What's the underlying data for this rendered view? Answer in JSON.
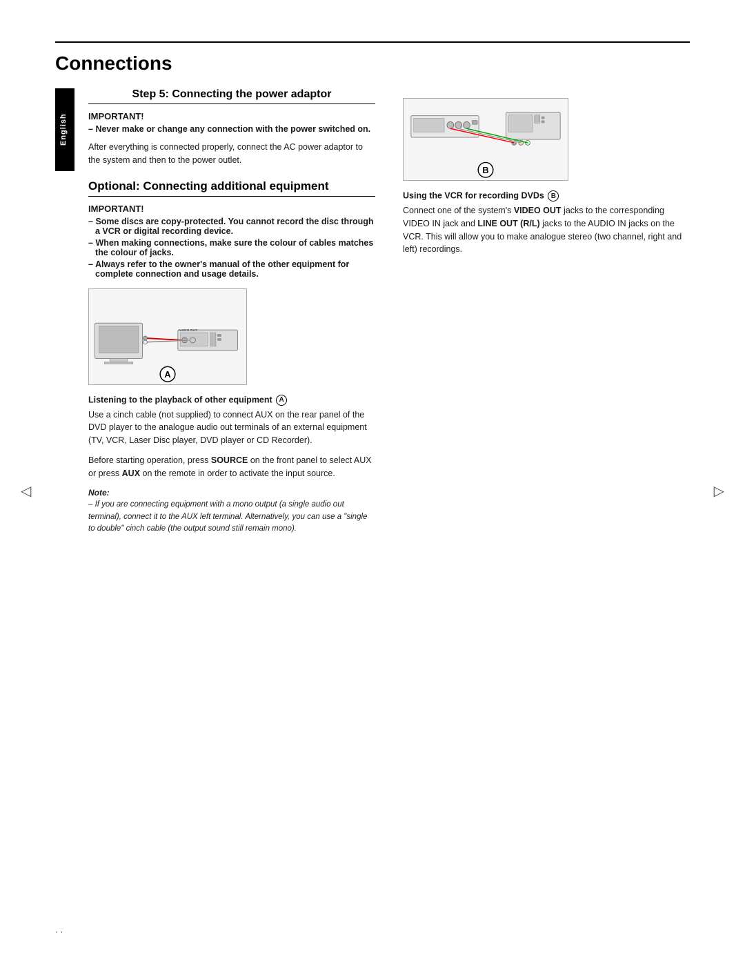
{
  "page": {
    "title": "Connections",
    "top_rule": true,
    "page_number": "· ·",
    "language_tab": "English"
  },
  "step5": {
    "heading": "Step 5:  Connecting the power adaptor",
    "important_label": "IMPORTANT!",
    "important_bullets": [
      "Never make or change any connection with the power switched on."
    ],
    "body_text": "After everything is connected properly, connect the AC power adaptor to the system and then to the power outlet."
  },
  "optional": {
    "heading": "Optional: Connecting additional equipment",
    "important_label": "IMPORTANT!",
    "important_bullets": [
      "Some discs are copy-protected. You cannot record the disc through a VCR or digital recording device.",
      "When making connections, make sure the colour of cables matches the colour of jacks.",
      "Always refer to the owner's manual of the other equipment for complete connection and usage details."
    ],
    "diagram_a_label": "A",
    "listening_heading": "Listening to the playback of other equipment",
    "listening_circle": "A",
    "listening_body1": "Use a cinch cable (not supplied) to connect AUX on the rear panel of the DVD player to the analogue audio out terminals of an external equipment (TV, VCR, Laser Disc player, DVD player or CD Recorder).",
    "listening_body2": "Before starting operation, press SOURCE on the front panel to select AUX or press AUX on the remote in order to activate the input source.",
    "listening_source_bold": "SOURCE",
    "listening_aux_bold": "AUX",
    "note_label": "Note:",
    "note_text": "– If you are connecting equipment with a mono output (a single audio out terminal), connect it to the AUX left terminal. Alternatively, you can use a \"single to double\" cinch cable (the output sound still remain mono)."
  },
  "right_column": {
    "diagram_b_label": "B",
    "vcr_heading_prefix": "Using the VCR for recording DVDs",
    "vcr_circle": "B",
    "vcr_body1": "Connect one of the system's",
    "vcr_video_out_bold": "VIDEO OUT",
    "vcr_body2": "jacks to the corresponding VIDEO IN jack and",
    "vcr_line_out_bold": "LINE OUT (R/L)",
    "vcr_body3": "jacks to the AUDIO IN jacks on the VCR. This will allow you to make analogue stereo (two channel, right and left) recordings."
  },
  "nav": {
    "left_arrow": "◁",
    "right_arrow": "▷"
  }
}
